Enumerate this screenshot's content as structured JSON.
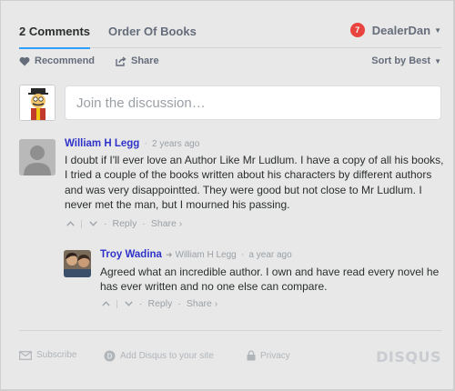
{
  "nav": {
    "tabs": [
      {
        "label": "2 Comments"
      },
      {
        "label": "Order Of Books"
      }
    ],
    "user": {
      "badge": "7",
      "name": "DealerDan"
    }
  },
  "toolbar": {
    "recommend_label": "Recommend",
    "share_label": "Share",
    "sort_label": "Sort by Best"
  },
  "composer": {
    "placeholder": "Join the discussion…"
  },
  "comments": [
    {
      "author": "William H Legg",
      "time": "2 years ago",
      "text": "I doubt if I'll ever love an Author Like Mr Ludlum. I have a copy of all his books, I tried a couple of the books written about his characters by different authors and was very disappointted. They were good but not close to Mr Ludlum. I never met the man, but I mourned his passing.",
      "reply_label": "Reply",
      "share_label": "Share ›"
    },
    {
      "author": "Troy Wadina",
      "reply_to": "William H Legg",
      "time": "a year ago",
      "text": "Agreed what an incredible author. I own and have read every novel he has ever written and no one else can compare.",
      "reply_label": "Reply",
      "share_label": "Share ›"
    }
  ],
  "footer": {
    "subscribe_label": "Subscribe",
    "add_disqus_label": "Add Disqus to your site",
    "privacy_label": "Privacy",
    "brand": "DISQUS"
  },
  "colors": {
    "accent": "#2e9fff",
    "author_link": "#2f33c9",
    "badge": "#e9433f",
    "background": "#e8e8e8"
  }
}
